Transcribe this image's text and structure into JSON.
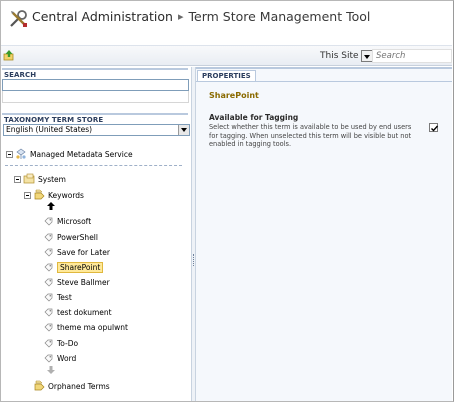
{
  "header": {
    "app_title": "Central Administration",
    "separator": "▸",
    "page_title": "Term Store Management Tool"
  },
  "toolbar": {
    "scope_label": "This Site",
    "search_placeholder": "Search"
  },
  "left_pane": {
    "search_heading": "SEARCH",
    "search_value": "",
    "taxonomy_heading": "TAXONOMY TERM STORE",
    "language": "English (United States)",
    "tree": {
      "root": "Managed Metadata Service",
      "system": "System",
      "keywords": "Keywords",
      "terms": [
        "Microsoft",
        "PowerShell",
        "Save for Later",
        "SharePoint",
        "Steve Ballmer",
        "Test",
        "test dokument",
        "theme ma opulwnt",
        "To-Do",
        "Word"
      ],
      "selected_term": "SharePoint",
      "orphaned": "Orphaned Terms"
    }
  },
  "right_pane": {
    "tab_label": "PROPERTIES",
    "term_name": "SharePoint",
    "available_label": "Available for Tagging",
    "available_desc": "Select whether this term is available to be used by end users for tagging. When unselected this term will be visible but not enabled in tagging tools.",
    "available_checked": true
  },
  "colors": {
    "accent": "#2c3e5e",
    "selection": "#ffe99a",
    "term_title": "#8a6a00"
  }
}
